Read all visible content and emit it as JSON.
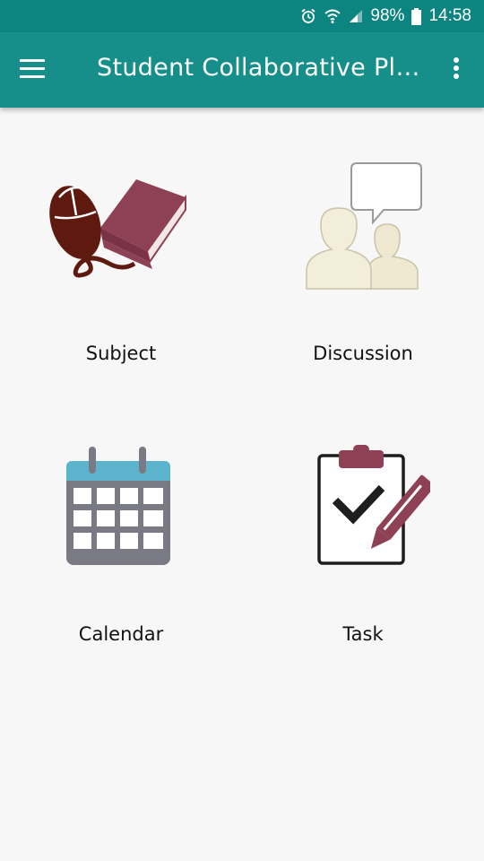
{
  "status_bar": {
    "battery": "98%",
    "time": "14:58",
    "icons": [
      "alarm-icon",
      "wifi-icon",
      "signal-icon",
      "battery-icon"
    ]
  },
  "app_bar": {
    "title": "Student Collaborative Pl…",
    "color": "#168f8b",
    "icons": [
      "hamburger-menu-icon",
      "more-vert-icon"
    ]
  },
  "menu": [
    {
      "label": "Subject",
      "icon": "mouse-book-icon"
    },
    {
      "label": "Discussion",
      "icon": "discussion-people-icon"
    },
    {
      "label": "Calendar",
      "icon": "calendar-icon"
    },
    {
      "label": "Task",
      "icon": "task-clipboard-icon"
    }
  ]
}
